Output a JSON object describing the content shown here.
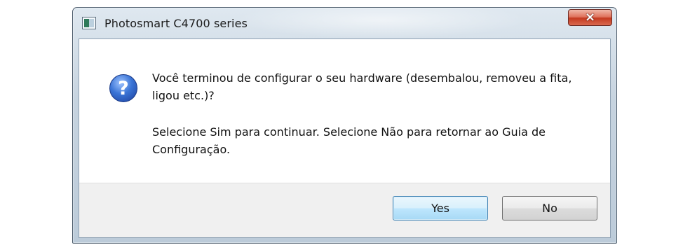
{
  "window": {
    "title": "Photosmart C4700 series",
    "close_label": "×"
  },
  "dialog": {
    "icon": "question-icon",
    "icon_glyph": "?",
    "message_line1": "Você terminou de configurar o seu hardware (desembalou, removeu a fita, ligou etc.)?",
    "message_line2": "Selecione Sim para continuar. Selecione Não para retornar ao Guia de Configuração."
  },
  "buttons": {
    "yes_label": "Yes",
    "no_label": "No"
  },
  "colors": {
    "close_button": "#c43b21",
    "default_button_border": "#3c7fb1",
    "question_icon": "#3a74d6"
  }
}
